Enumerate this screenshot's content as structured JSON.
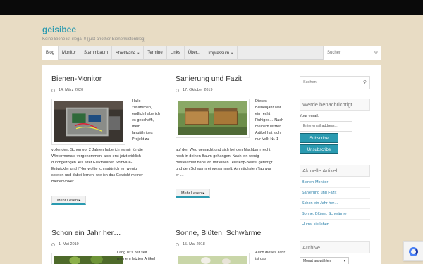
{
  "site": {
    "title": "geisibee",
    "tagline": "Keine Biene ist illegal !! (just another Bienenkistenblog)"
  },
  "nav": {
    "items": [
      {
        "label": "Blog",
        "has_dropdown": false,
        "active": true
      },
      {
        "label": "Monitor",
        "has_dropdown": false,
        "active": false
      },
      {
        "label": "Stammbaum",
        "has_dropdown": false,
        "active": false
      },
      {
        "label": "Stockkarte",
        "has_dropdown": true,
        "active": false
      },
      {
        "label": "Termine",
        "has_dropdown": false,
        "active": false
      },
      {
        "label": "Links",
        "has_dropdown": false,
        "active": false
      },
      {
        "label": "Über...",
        "has_dropdown": false,
        "active": false
      },
      {
        "label": "Impressum",
        "has_dropdown": true,
        "active": false
      }
    ],
    "search_placeholder": "Suchen"
  },
  "posts": [
    {
      "title": "Bienen-Monitor",
      "date": "14. März 2020",
      "excerpt_side": [
        "Hallo",
        "zusammen,",
        "endlich habe ich",
        "es geschafft,",
        "mein",
        "langjähriges",
        "Projekt zu"
      ],
      "excerpt_full": [
        "vollenden. Schon vor 2 Jahren habe ich es mir für die",
        "Wintermonate vorgenommen, aber erst jetzt wirklich",
        "durchgezogen. Als alter Elektroniker, Software-",
        "Entwickler und IT-ler wollte ich natürlich ein wenig",
        "spielen und dabei lernen, wie ich das Gewicht meiner",
        "Bienenvölker …"
      ],
      "more": "Mehr Lesen",
      "image_icon": "electronics-box-photo"
    },
    {
      "title": "Sanierung und Fazit",
      "date": "17. Oktober 2019",
      "excerpt_side": [
        "Dieses",
        "Bienenjahr war",
        "ein recht",
        "Ruhiges… Nach",
        "meinem letzten",
        "Artikel hat sich",
        "nur Volk Nr. 1"
      ],
      "excerpt_full": [
        "auf den Weg gemacht und sich bei den Nachbarn recht",
        "hoch in deinen Baum gehangen. Nach ein wenig",
        "Bastelarbeit habe ich mir einen Teleskop-Beutel gefertigt",
        "und den Schwarm eingesammelt. Am nächsten Tag war",
        "er …"
      ],
      "more": "Mehr Lesen",
      "image_icon": "beehives-photo"
    },
    {
      "title": "Schon ein Jahr her…",
      "date": "1. Mai 2019",
      "excerpt_side": [
        "Lang ist's her seit",
        "meinem letzten Artikel"
      ],
      "image_icon": "garden-photo"
    },
    {
      "title": "Sonne, Blüten, Schwärme",
      "date": "15. Mai 2018",
      "excerpt_side": [
        "Auch dieses Jahr",
        "ist das"
      ],
      "image_icon": "blossom-photo"
    }
  ],
  "sidebar": {
    "search_placeholder": "Suchen",
    "notify_heading": "Werde benachrichtigt",
    "email_label": "Your email:",
    "email_placeholder": "Enter email address...",
    "subscribe": "Subscribe",
    "unsubscribe": "Unsubscribe",
    "recent_heading": "Aktuelle Artikel",
    "recent": [
      "Bienen-Monitor",
      "Sanierung und Fazit",
      "Schon ein Jahr her…",
      "Sonne, Blüten, Schwärme",
      "Hurra, sie leben"
    ],
    "archive_heading": "Archive",
    "archive_select": "Monat auswählen"
  },
  "colors": {
    "accent": "#2a9ab0",
    "background": "#e8dcc4",
    "topbar": "#0a0a0a"
  }
}
